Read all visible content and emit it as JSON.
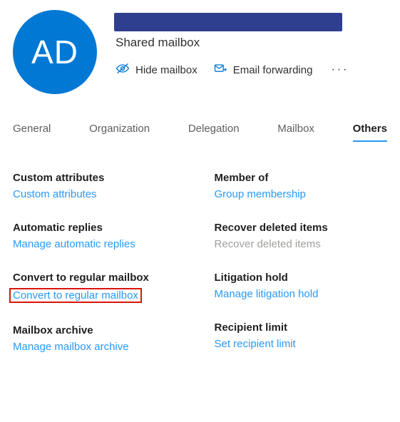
{
  "header": {
    "avatar_initials": "AD",
    "subtitle": "Shared mailbox",
    "actions": {
      "hide": "Hide mailbox",
      "forwarding": "Email forwarding"
    }
  },
  "tabs": {
    "general": "General",
    "organization": "Organization",
    "delegation": "Delegation",
    "mailbox": "Mailbox",
    "others": "Others"
  },
  "sections": {
    "custom_attributes": {
      "title": "Custom attributes",
      "link": "Custom attributes"
    },
    "automatic_replies": {
      "title": "Automatic replies",
      "link": "Manage automatic replies"
    },
    "convert": {
      "title": "Convert to regular mailbox",
      "link": "Convert to regular mailbox"
    },
    "archive": {
      "title": "Mailbox archive",
      "link": "Manage mailbox archive"
    },
    "member_of": {
      "title": "Member of",
      "link": "Group membership"
    },
    "recover": {
      "title": "Recover deleted items",
      "link": "Recover deleted items"
    },
    "litigation": {
      "title": "Litigation hold",
      "link": "Manage litigation hold"
    },
    "recipient": {
      "title": "Recipient limit",
      "link": "Set recipient limit"
    }
  },
  "colors": {
    "accent": "#0078d4",
    "link": "#2899f5",
    "highlight": "#d8150a"
  }
}
